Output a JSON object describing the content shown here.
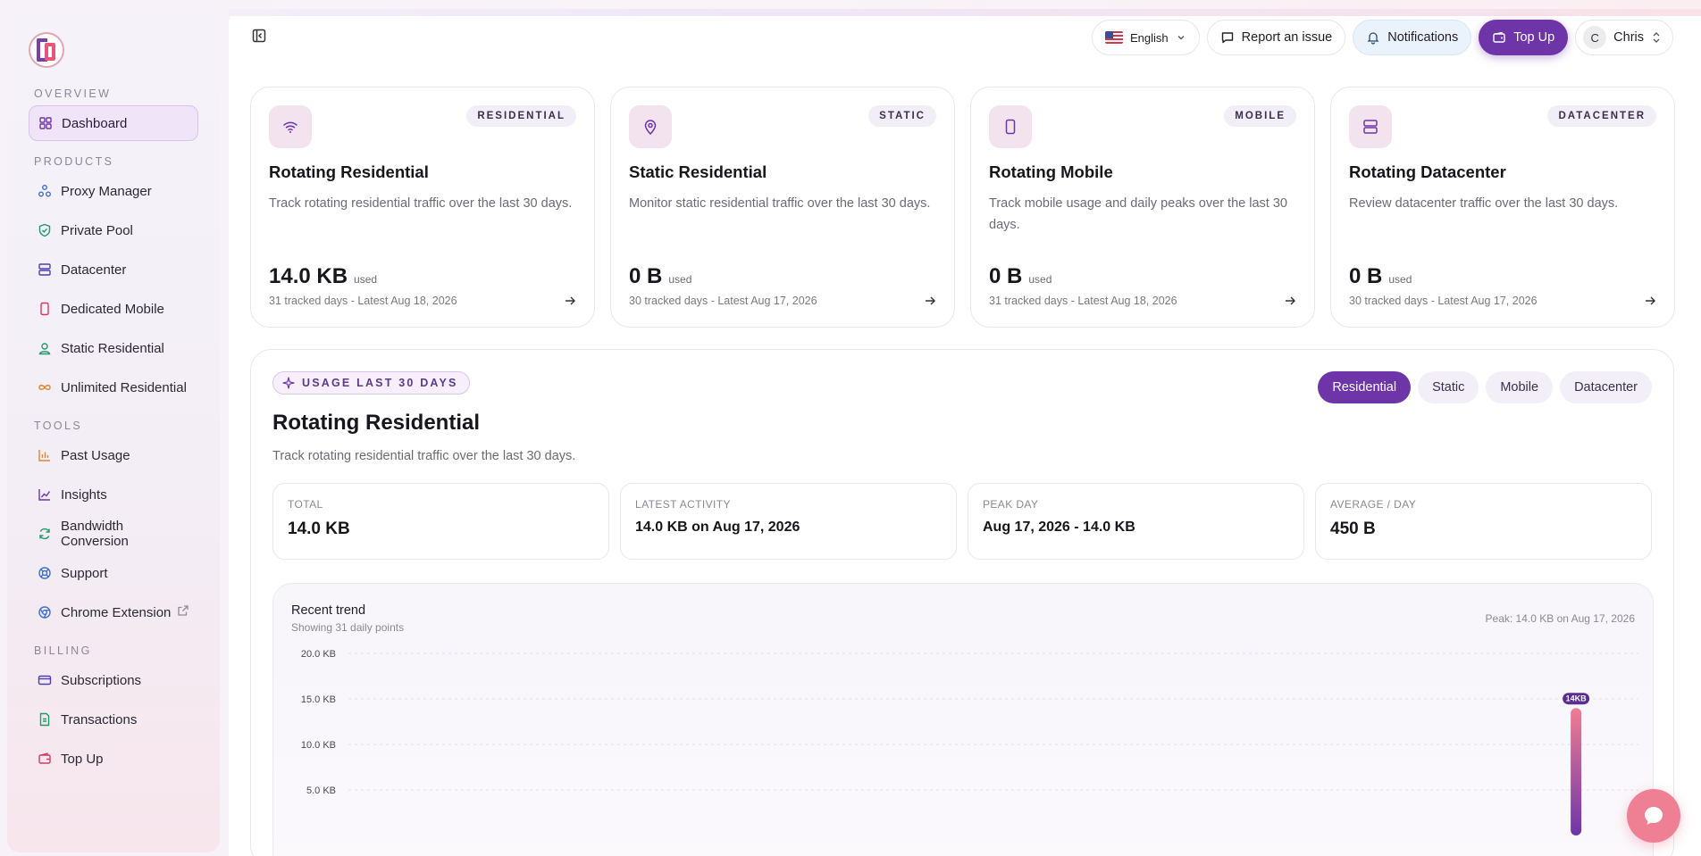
{
  "sidebar": {
    "sections": [
      {
        "title": "OVERVIEW",
        "items": [
          {
            "label": "Dashboard",
            "icon": "grid-icon"
          }
        ]
      },
      {
        "title": "PRODUCTS",
        "items": [
          {
            "label": "Proxy Manager",
            "icon": "network-icon"
          },
          {
            "label": "Private Pool",
            "icon": "shield-check-icon"
          },
          {
            "label": "Datacenter",
            "icon": "server-icon"
          },
          {
            "label": "Dedicated Mobile",
            "icon": "smartphone-icon"
          },
          {
            "label": "Static Residential",
            "icon": "user-pin-icon"
          },
          {
            "label": "Unlimited Residential",
            "icon": "infinity-icon"
          }
        ]
      },
      {
        "title": "TOOLS",
        "items": [
          {
            "label": "Past Usage",
            "icon": "bar-chart-icon"
          },
          {
            "label": "Insights",
            "icon": "line-chart-icon"
          },
          {
            "label": "Bandwidth Conversion",
            "icon": "refresh-icon"
          },
          {
            "label": "Support",
            "icon": "lifebuoy-icon"
          },
          {
            "label": "Chrome Extension",
            "icon": "chrome-icon"
          }
        ]
      },
      {
        "title": "BILLING",
        "items": [
          {
            "label": "Subscriptions",
            "icon": "credit-card-icon"
          },
          {
            "label": "Transactions",
            "icon": "receipt-icon"
          },
          {
            "label": "Top Up",
            "icon": "wallet-icon"
          }
        ]
      }
    ]
  },
  "topbar": {
    "language": "English",
    "report": "Report an issue",
    "notifications": "Notifications",
    "topup": "Top Up",
    "user_initial": "C",
    "user_name": "Chris"
  },
  "cards": [
    {
      "badge": "RESIDENTIAL",
      "title": "Rotating Residential",
      "desc": "Track rotating residential traffic over the last 30 days.",
      "value": "14.0 KB",
      "unit": "used",
      "meta": "31 tracked days - Latest Aug 18, 2026",
      "icon": "wifi-icon"
    },
    {
      "badge": "STATIC",
      "title": "Static Residential",
      "desc": "Monitor static residential traffic over the last 30 days.",
      "value": "0 B",
      "unit": "used",
      "meta": "30 tracked days - Latest Aug 17, 2026",
      "icon": "map-pin-icon"
    },
    {
      "badge": "MOBILE",
      "title": "Rotating Mobile",
      "desc": "Track mobile usage and daily peaks over the last 30 days.",
      "value": "0 B",
      "unit": "used",
      "meta": "31 tracked days - Latest Aug 18, 2026",
      "icon": "smartphone-icon"
    },
    {
      "badge": "DATACENTER",
      "title": "Rotating Datacenter",
      "desc": "Review datacenter traffic over the last 30 days.",
      "value": "0 B",
      "unit": "used",
      "meta": "30 tracked days - Latest Aug 17, 2026",
      "icon": "server-icon"
    }
  ],
  "usage": {
    "tag": "USAGE LAST 30 DAYS",
    "title": "Rotating Residential",
    "desc": "Track rotating residential traffic over the last 30 days.",
    "tabs": [
      "Residential",
      "Static",
      "Mobile",
      "Datacenter"
    ],
    "active_tab": "Residential",
    "stats": [
      {
        "label": "TOTAL",
        "value": "14.0 KB"
      },
      {
        "label": "LATEST ACTIVITY",
        "value": "14.0 KB on Aug 17, 2026"
      },
      {
        "label": "PEAK DAY",
        "value": "Aug 17, 2026 - 14.0 KB"
      },
      {
        "label": "AVERAGE / DAY",
        "value": "450 B"
      }
    ],
    "trend": {
      "title": "Recent trend",
      "subtitle": "Showing 31 daily points",
      "peak": "Peak: 14.0 KB on Aug 17, 2026"
    }
  },
  "chart_data": {
    "type": "bar",
    "title": "Recent trend",
    "y_ticks": [
      "20.0 KB",
      "15.0 KB",
      "10.0 KB",
      "5.0 KB"
    ],
    "ylim": [
      0,
      20
    ],
    "y_unit": "KB",
    "grid": true,
    "points_count": 31,
    "series": [
      {
        "values": [
          0,
          0,
          0,
          0,
          0,
          0,
          0,
          0,
          0,
          0,
          0,
          0,
          0,
          0,
          0,
          0,
          0,
          0,
          0,
          0,
          0,
          0,
          0,
          0,
          0,
          0,
          0,
          0,
          0,
          14,
          0
        ]
      }
    ],
    "peak_label": "14KB",
    "colors": {
      "bar_top": "#f07d92",
      "bar_bottom": "#6d35a8",
      "label_bg": "#5b2d91"
    }
  },
  "colors": {
    "accent": "#6d35a8",
    "brand_pink": "#e8577a",
    "chat_fab": "#ef7f93"
  }
}
